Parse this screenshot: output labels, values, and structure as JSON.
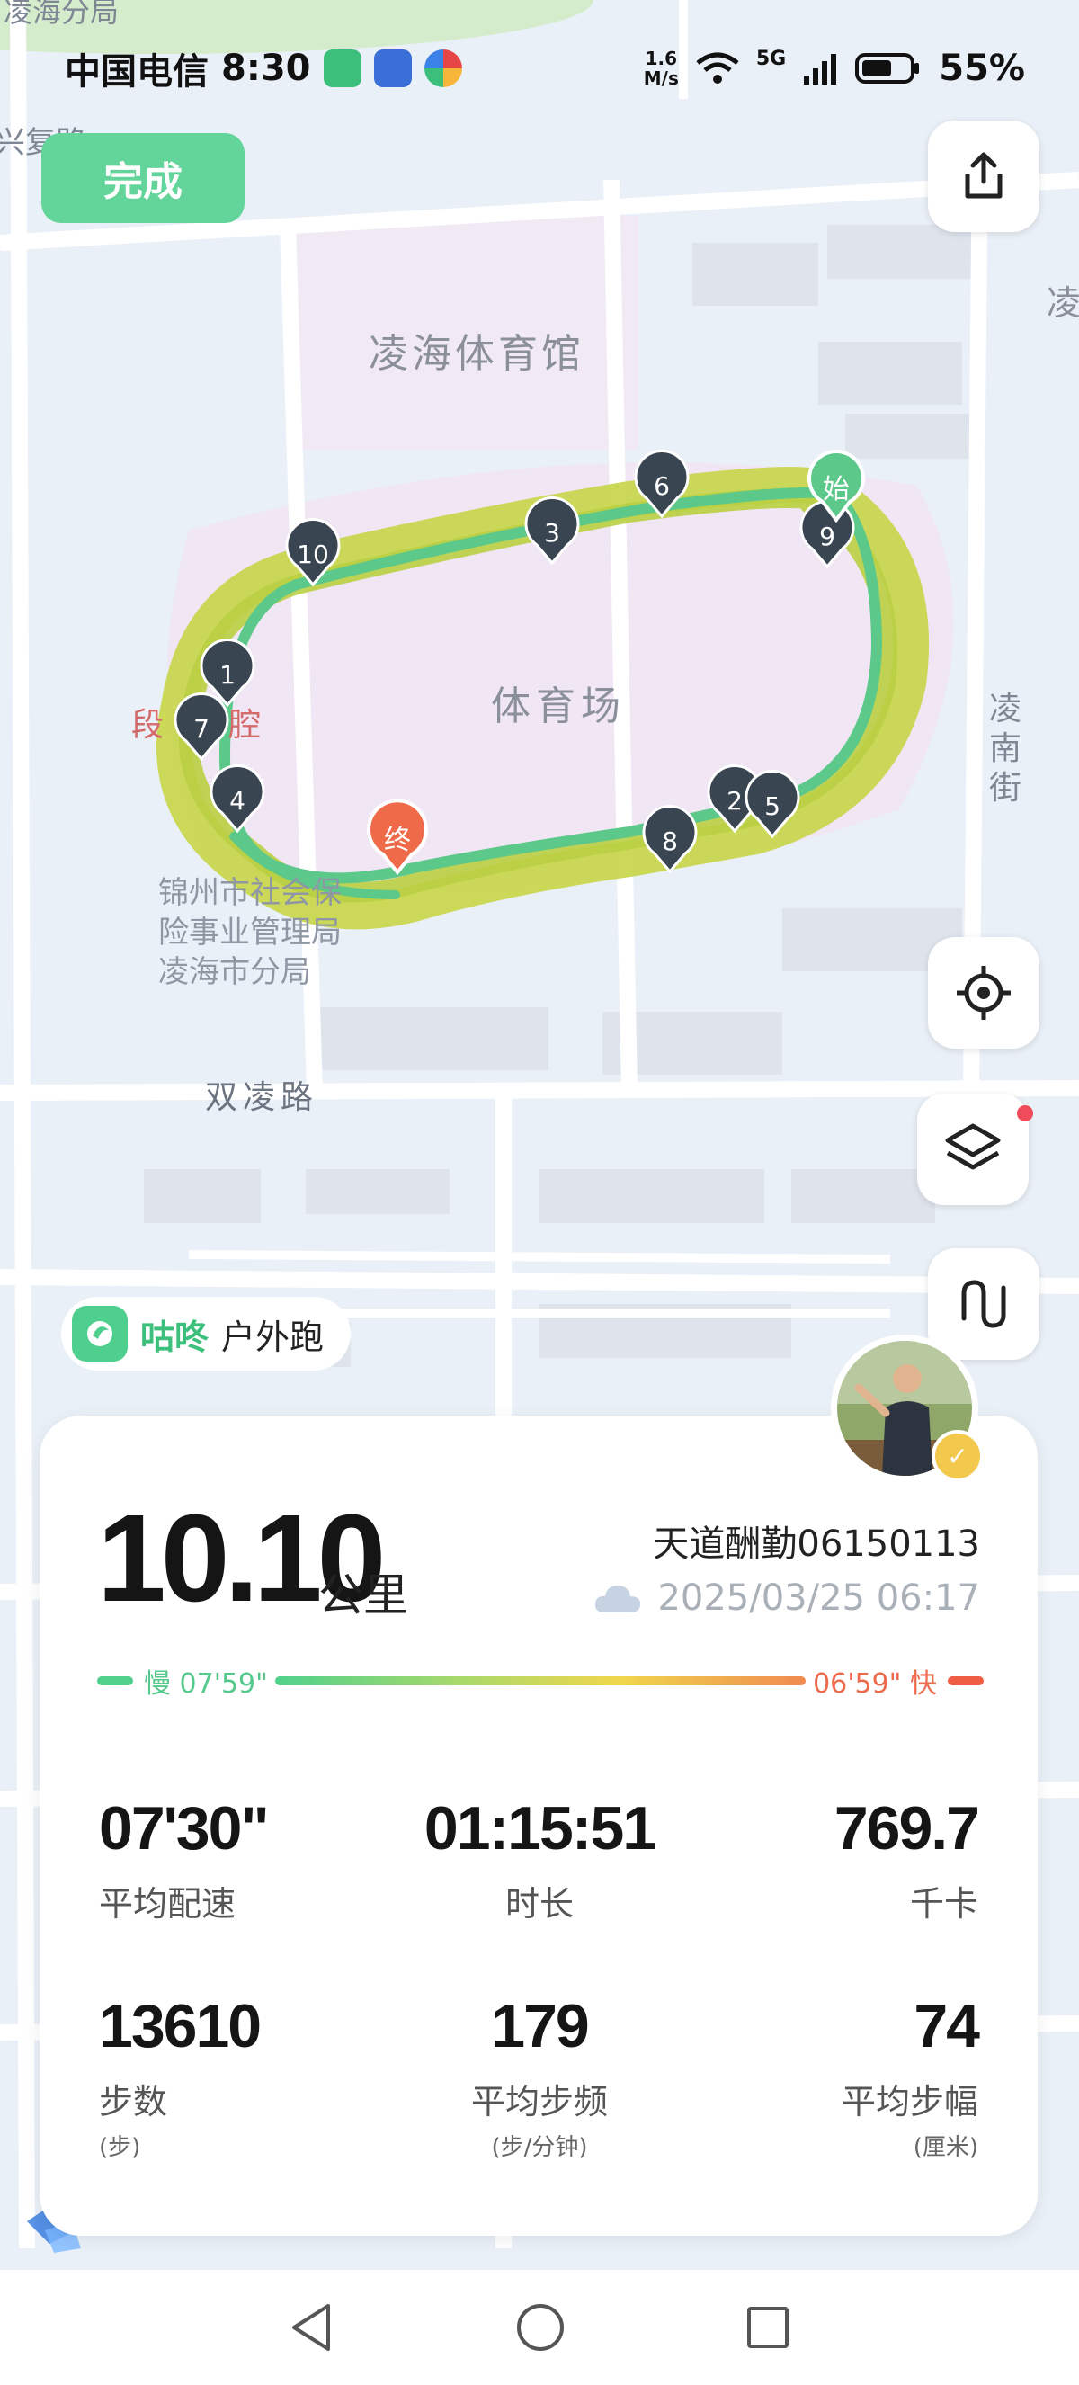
{
  "status_bar": {
    "carrier": "中国电信",
    "time": "8:30",
    "network_speed_value": "1.6",
    "network_speed_unit": "M/s",
    "signal_label": "5G",
    "battery": "55%"
  },
  "header": {
    "done_label": "完成"
  },
  "map": {
    "labels": {
      "top_left_poi": "凌海分局",
      "road_top_left": "兴复路",
      "gym": "凌海体育馆",
      "stadium": "体育场",
      "street_right": "凌南街",
      "right_edge_fragment": "凌",
      "road_bottom": "双凌路",
      "poi_left_red": "段　　腔",
      "bureau_line1": "锦州市社会保",
      "bureau_line2": "险事业管理局",
      "bureau_line3": "凌海市分局"
    },
    "start_label": "始",
    "end_label": "终",
    "km_markers": [
      "1",
      "2",
      "3",
      "4",
      "5",
      "6",
      "7",
      "8",
      "9",
      "10"
    ]
  },
  "brand": {
    "app_name": "咕咚",
    "activity": "户外跑"
  },
  "summary": {
    "distance": "10.10",
    "distance_unit": "公里",
    "username": "天道酬勤06150113",
    "datetime": "2025/03/25 06:17",
    "pace_slow_label": "慢 07'59\"",
    "pace_fast_label": "06'59\" 快",
    "stats": [
      {
        "value": "07'30\"",
        "label": "平均配速",
        "sub": ""
      },
      {
        "value": "01:15:51",
        "label": "时长",
        "sub": ""
      },
      {
        "value": "769.7",
        "label": "千卡",
        "sub": ""
      },
      {
        "value": "13610",
        "label": "步数",
        "sub": "(步)"
      },
      {
        "value": "179",
        "label": "平均步频",
        "sub": "(步/分钟)"
      },
      {
        "value": "74",
        "label": "平均步幅",
        "sub": "(厘米)"
      }
    ]
  },
  "colors": {
    "accent_green": "#63d49a",
    "track_yellow": "#c8d64a",
    "track_green": "#5cc98a",
    "marker_dark": "#3a4552",
    "end_marker": "#ef6a48"
  }
}
